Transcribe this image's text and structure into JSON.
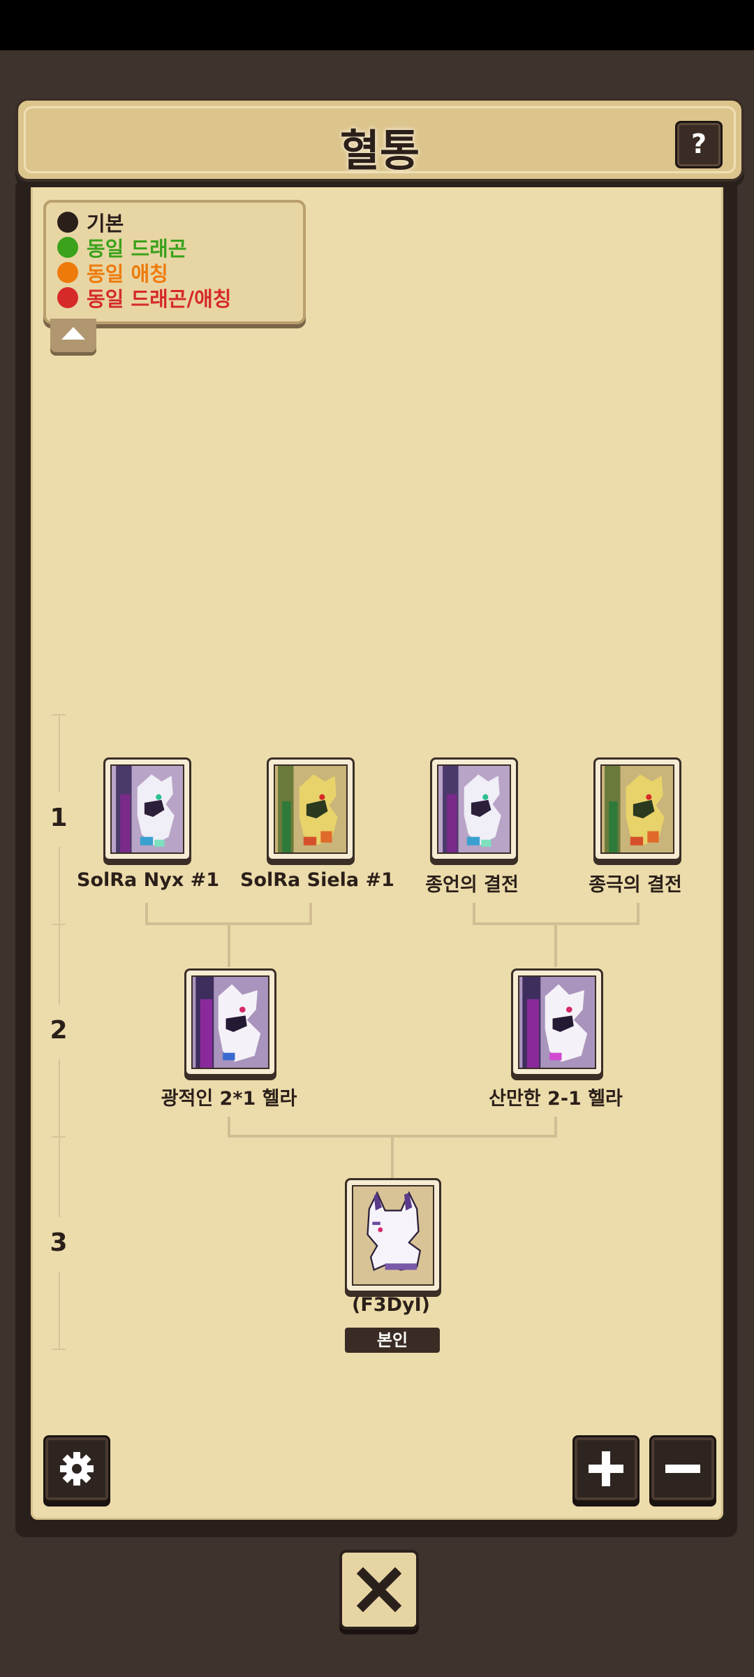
{
  "header": {
    "title": "혈통",
    "help_label": "?"
  },
  "legend": {
    "items": [
      {
        "label": "기본",
        "color": "#2b1f1a"
      },
      {
        "label": "동일 드래곤",
        "color": "#3aa21b"
      },
      {
        "label": "동일 애칭",
        "color": "#ee7a0b"
      },
      {
        "label": "동일 드래곤/애칭",
        "color": "#d52a28"
      }
    ]
  },
  "generations": [
    "1",
    "2",
    "3"
  ],
  "gen1": [
    {
      "name": "SolRa Nyx #1",
      "palette": "purple"
    },
    {
      "name": "SolRa Siela #1",
      "palette": "green"
    },
    {
      "name": "종언의 결전",
      "palette": "purple"
    },
    {
      "name": "종극의 결전",
      "palette": "green"
    }
  ],
  "gen2": [
    {
      "name": "광적인 2*1 헬라",
      "palette": "purple"
    },
    {
      "name": "산만한 2-1 헬라",
      "palette": "purple"
    }
  ],
  "gen3": {
    "name": "(F3DyI)",
    "badge": "본인"
  },
  "controls": {
    "zoom_in_icon": "plus-icon",
    "zoom_out_icon": "minus-icon",
    "settings_icon": "gear-icon",
    "close_icon": "close-icon"
  }
}
